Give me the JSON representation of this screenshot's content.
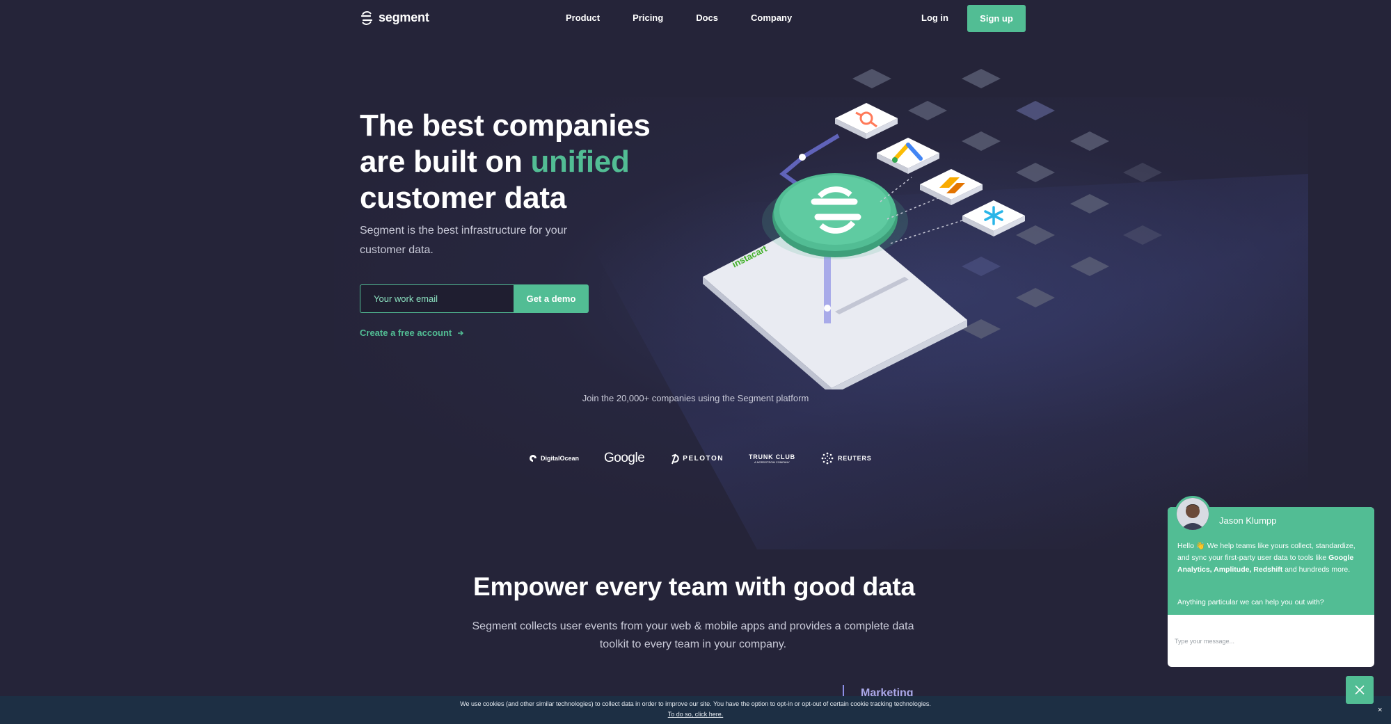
{
  "nav": {
    "logo_text": "segment",
    "links": [
      "Product",
      "Pricing",
      "Docs",
      "Company"
    ],
    "login": "Log in",
    "signup": "Sign up"
  },
  "hero": {
    "title_line1": "The best companies",
    "title_line2_pre": "are built on ",
    "title_accent": "unified",
    "title_line3": "customer data",
    "subtitle": "Segment is the best infrastructure for your customer data.",
    "email_placeholder": "Your work email",
    "demo_button": "Get a demo",
    "free_link": "Create a free account",
    "illustration_brand": "instacart"
  },
  "customers": {
    "join_text": "Join the 20,000+ companies using the Segment platform",
    "logos": [
      "DigitalOcean",
      "Google",
      "PELOTON",
      "TRUNK CLUB",
      "REUTERS"
    ],
    "trunk_sub": "A NORDSTROM COMPANY"
  },
  "section2": {
    "title": "Empower every team with good data",
    "subtitle": "Segment collects user events from your web & mobile apps and provides a complete data toolkit to every team in your company.",
    "tab_label": "Marketing"
  },
  "cookie": {
    "text": "We use cookies (and other similar technologies) to collect data in order to improve our site. You have the option to opt-in or opt-out of certain cookie tracking technologies.",
    "link": "To do so, click here.",
    "close": "×"
  },
  "chat": {
    "agent_name": "Jason Klumpp",
    "msg_part1": "Hello 👋 We help teams like yours collect, standardize, and sync your first-party user data to tools like ",
    "msg_bold": "Google Analytics, Amplitude, Redshift",
    "msg_part2": " and hundreds more.",
    "question": "Anything particular we can help you out with?",
    "input_placeholder": "Type your message..."
  },
  "colors": {
    "background": "#252439",
    "accent": "#52bd94",
    "cookie_bar": "#1d2f44"
  }
}
